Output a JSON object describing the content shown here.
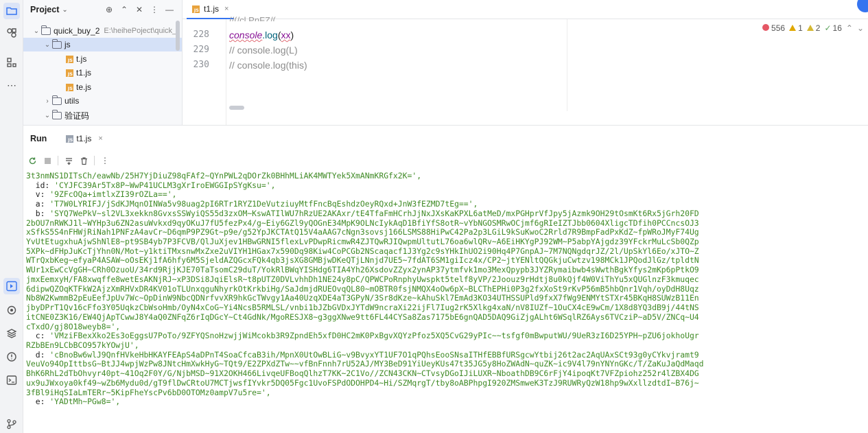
{
  "activity_bar": {
    "items": [
      {
        "name": "project-icon",
        "active": true
      },
      {
        "name": "plugins-icon"
      },
      {
        "name": "structure-icon"
      },
      {
        "name": "more-icon",
        "glyph": "⋯"
      },
      {
        "name": "run-icon",
        "active": true
      },
      {
        "name": "services-icon"
      },
      {
        "name": "layers-icon"
      },
      {
        "name": "problems-icon"
      },
      {
        "name": "terminal-icon"
      },
      {
        "name": "git-icon"
      }
    ]
  },
  "project_panel": {
    "title": "Project",
    "tree": [
      {
        "label": "quick_buy_2",
        "hint": "E:\\heihePoject\\quick_",
        "type": "folder",
        "open": true,
        "depth": 0
      },
      {
        "label": "js",
        "type": "folder",
        "open": true,
        "depth": 1,
        "selected": true
      },
      {
        "label": "t.js",
        "type": "js",
        "depth": 2
      },
      {
        "label": "t1.js",
        "type": "js",
        "depth": 2
      },
      {
        "label": "te.js",
        "type": "js",
        "depth": 2
      },
      {
        "label": "utils",
        "type": "folder",
        "open": false,
        "depth": 1
      },
      {
        "label": "验证码",
        "type": "folder",
        "open": true,
        "depth": 1
      }
    ]
  },
  "editor": {
    "tab": {
      "label": "t1.js",
      "close": "×"
    },
    "cut_line": "//(/cl PnFZ/(",
    "lines": [
      {
        "number": "228",
        "kind": "console_log",
        "obj": "console",
        "method": ".log",
        "open": "(",
        "arg": "xx",
        "close": ")"
      },
      {
        "number": "229",
        "kind": "comment",
        "text": "// console.log(L)"
      },
      {
        "number": "230",
        "kind": "comment",
        "text": "// console.log(this)"
      }
    ],
    "inspections": {
      "errors": "556",
      "warnings": "1",
      "weak_warnings": "2",
      "ok": "16"
    }
  },
  "run_panel": {
    "title": "Run",
    "tab_label": "t1.js",
    "tab_close": "×",
    "console_lines": [
      "3t3nmNS1DITsCh/eawNb/25H7YjDiuZ98qFAf2~QYnPWL2qDOrZk0BHhMLiAK4MWTYek5XmANmKRGfx2K=',",
      "  id: 'CYJFC39Ar5Tx8P~WwP41UCLM3gXrIroEWGGIpSYgKsu=',",
      "  v: '9ZFcOQa+imtlxZI39rOZLa==',",
      "  a: 'T7W0LYRIFJ/jSdKJMqnOINWa5v98uag2pI6RTr1RYZ1DeVutziuyMtfFncBqEshdzOeyRQxd+JnW3fEZMD7tEg==',",
      "  b: 'SYQ7WePkV~sl2VL3xekkn8GvxsSSWyiQS55d3zxOM~KswATIlWU7hRzUE2AKAxr/tE4TfaFmHCrhJjNxJXsKaKPXL6atMeD/mxPGHprVfJpy5jAzmk9OH29tOsmKt6Rx5jGrh20FD",
      "2bOU7nRWKJ1l~WYHp3u6ZN2asuWvkxd9qyOKuJ7fU5fezPx4/g~Eiy6GZl9yQOGnE34MpK9OLNcIykAqD1BfiYfS8otR~vYbNGOSMRwOCjmf6gRIeIZTJbb0604XligcTDfih0PCCncsOJ3",
      "xSfkS5S4nFHWjRiNah1PNFzA4avCr~D6qmP9PZ9Gt~p9e/g52YpJKCTAtQ15V4aAAG7cNgn3sovsj166LSMS88HiPwC42Pa2p3LGiL9kSuKwoC2Rrld7R9BmpFadPxKdZ~fpWRoJMyF74Ug",
      "YvUtEtugxhuAjwShNlE8~pt9SB4yb7P3FCVB/QlJuXjev1HBwGRNI5flexLvPDwpRicmwR4ZJTQwRJIQwpmUltutL76oa6wlQRv~A6EiHKYgPJ92WM~P5abpYAjgdz39YFckrMuLcSb0QZp",
      "5XPk~dFHpJuKcTjYhn0N/Mot~y1ktiTMxsnwMxZxe2uVIYH1HGax7x590Dq98Kiw4CoPCGb2NScaqacf1J3Yg2c9sYHkIhUO2i90Hq4P7GnpAJ~7M7NQNgdqrJZ/2l/UpSkYl6Eo/xJTO~Z",
      "WTrQxbKeg~efyaP4ASAW~oOsEKj1fA6hfy6M5SjeldAZQGcxFQk4qb3jsXG8GMBjwDKeQTjLNnjd7UE5~7fdAT6SM1giIcz4x/CP2~jtYENltQQGkjuCwtzv198MCk1JPQodJlGz/tpldtN",
      "WUr1xEwCcVgGH~CRh0OzuoU/34rd9RjjKJE70TaTsomC29duT/YokRlBWqYISHdg6TIA4Yh26XsdovZZyx2ynAP37ytmfvk1mo3MexQpypb3JYZRymaibwb4sWwthBgkYfys2mKp6pPtkO9",
      "jmxEemxyH/FA8xwqffe8wetEsAKNjRJ~xP3DSi8JqiElsR~t8pUTZ0DVLvhhDh1NE24y8pC/QPWCPoRnphyUwspkt5telf8yVP/2Joouz9rHdtj8u0kQjf4W0ViThYu5xQUGlnzF3kmuqec",
      "6dipwQZOqKTFkW2AjzXmRHVxDR4KV01oTLUnxqguNhyrkOtKrkbiHg/SaJdmjdRUEOvqQL80~mOBTR0fsjNMQX4oOw6pX~BLCThEPHi0P3g2fxXoSt9rKvP56mB5hbQnr1Vqh/oyDdH8Uqz",
      "Nb8W2KwmmB2pEuEefJpUv7Wc~OpDinW9NbcQDNrfvvXR9hkGcTWvgy1Aa40UzqXDE4aT3GPyN/3Sr8dKze~kAhuSkl7EmAd3KO34UTHSSUPld9fxX7fWg9ENMYtSTXr45BKqH8SUWzB11En",
      "jbyDPrT1Qv16cFfo3Y05UqkzCbWsoHmb/OyN4xCoG~Yi4NcsB5RMLSL/vnbi1bJZbGVDxJYTdW9ncraXi22ijFl7Iug2rK5Xlkg4xaN/nV8IUZf~1OuCX4cE9wCm/1X8d8YQ3dB9j/44tNS",
      "itCNE0Z3K16/EW4QjApTCwwJ8Y4aQ0ZNFqZ6rIqDGcY~Ct4GdNk/MgoRESJX8~g3ggXNwe9tt6FL44CYSa8Zas7175bE6gnQAD5DAQ9GiZjgALht6WSqlRZ6Ays6TVCziP~aD5V/ZNCq~U4",
      "cTxdO/gj8O18weyb8=',",
      "  c: 'VMziFBexXko2Es3oEggsU7PoTo/9ZFYQSnoHzwjjWiMcokb3R9ZpndEh5xfD0HC2mK0PxBgvXQYzPfoz5XQ5CvG29yPIc~~tsfgf0mBwputWU/9UeR3zI6D25YPH~pZU6jokhoUgr",
      "RZbBEn9LCbBCO957kYOwjU',",
      "  d: 'cBnoBw6wlJ9QnfHVkeHbHKAYFEApS4aDPnT4SoaCfcaB3ih/MpnX0UtOwBLiG~v9BvyxYT1UF7O1qPQhsEooSNsaITHfEBBfURSgcwYtbij26t2ac2AqUAxSCt93g0yCYkvjramt9",
      "VeuVo94OpIttbsG~BtJJ4wpjWzPw8JNtcHmXwkHyG~TQt9/E2ZPXdZTw~~vfBnFnnh7rU52AJ/MY3BeD91YiUeyKUs47t35JG5y8HoZWAdN~quZK~ic9V4l79nYNYnGKc/T/ZaKuJaQdMaqd",
      "BhK6RhL2dTbOhvyr40pt~41Oq2F0Y/G/NjbMSD~91X2OKH466LivqeUFBoqQlhzT7KK~2C1Vo//ZCN43CKN~CTvsyDGoIJiLUXR~NboathDB9C6rFjY4ipoqKt7VFZpiohz252r4lZBX4DG",
      "ux9uJWxoya0kf49~wZb6Mydu0d/gT9flDwCRtoU7MCTjwsfIYvkr5DQ05Fgc1UvoFSPdODOHPD4~Hi/SZMqrgT/tby8oABPhpgI920ZMSmweK3TzJ9RUWRyQzW18hp9wXxllzdtdI~B76j~",
      "3fBl9iHqSIaLmTERr~5KipFheYscPv6bD0OTOMz0ampV7u5re=',",
      "  e: 'YADtMh~PGw8=',"
    ]
  }
}
